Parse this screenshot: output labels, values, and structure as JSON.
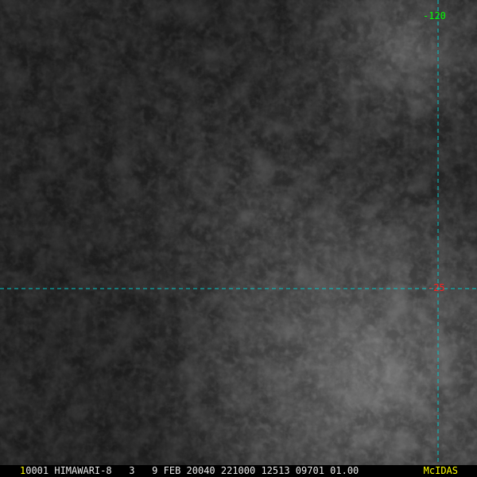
{
  "image": {
    "description_colors": {
      "background": "#1a1a1a",
      "cloud_dark": "#2a2a2a",
      "cloud_mid": "#4a4a4a",
      "cloud_bright": "#7a7a7a",
      "grid_line": "#00c8c8"
    }
  },
  "grid": {
    "longitude_label": "-120",
    "latitude_label": "-25",
    "longitude_color": "#00ff00",
    "latitude_color": "#ff2020"
  },
  "info_bar": {
    "frame_number": "1",
    "caption": "0001 HIMAWARI-8   3   9 FEB 20040 221000 12513 09701 01.00",
    "brand": "McIDAS",
    "frame_color": "#ffff00",
    "brand_color": "#ffff00"
  }
}
